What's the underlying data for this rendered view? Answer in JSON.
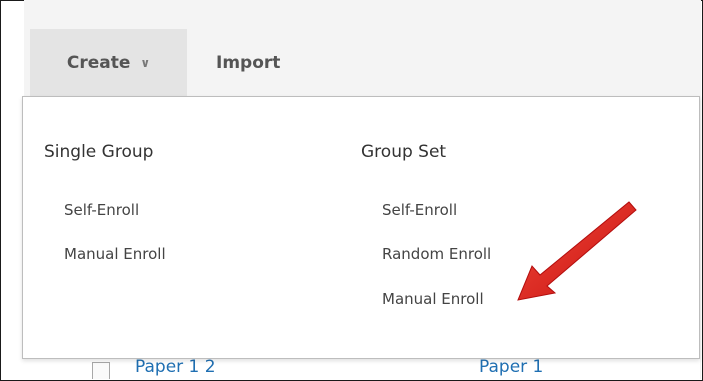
{
  "toolbar": {
    "create_label": "Create",
    "import_label": "Import"
  },
  "dropdown": {
    "single_group": {
      "heading": "Single Group",
      "items": [
        "Self-Enroll",
        "Manual Enroll"
      ]
    },
    "group_set": {
      "heading": "Group Set",
      "items": [
        "Self-Enroll",
        "Random Enroll",
        "Manual Enroll"
      ]
    }
  },
  "background_row": {
    "name_link": "Paper 1 2",
    "set_link": "Paper 1"
  },
  "colors": {
    "arrow": "#e01b1b",
    "link": "#1f6fb2"
  }
}
